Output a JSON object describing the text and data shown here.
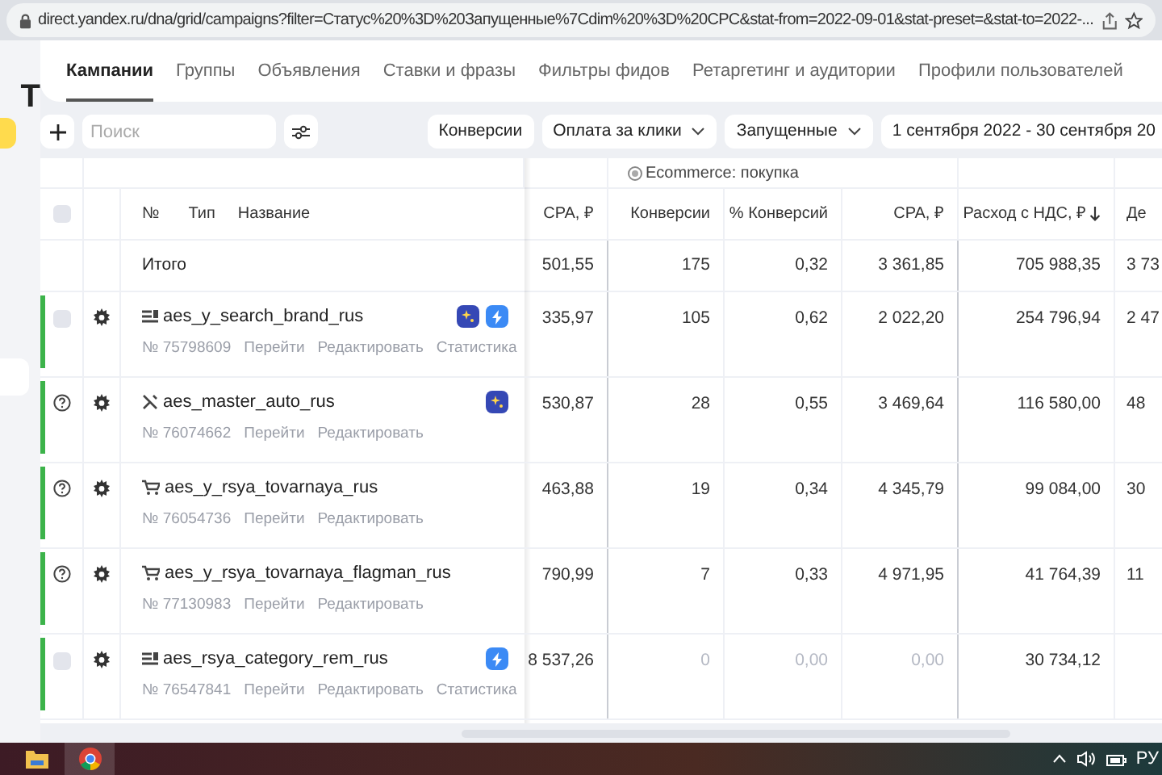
{
  "address_bar": {
    "url": "direct.yandex.ru/dna/grid/campaigns?filter=Статус%20%3D%20Запущенные%7Cdim%20%3D%20CPC&stat-from=2022-09-01&stat-preset=&stat-to=2022-..."
  },
  "sidebar": {
    "logo": "Т"
  },
  "tabs": [
    {
      "label": "Кампании",
      "selected": true
    },
    {
      "label": "Группы",
      "selected": false
    },
    {
      "label": "Объявления",
      "selected": false
    },
    {
      "label": "Ставки и фразы",
      "selected": false
    },
    {
      "label": "Фильтры фидов",
      "selected": false
    },
    {
      "label": "Ретаргетинг и аудитории",
      "selected": false
    },
    {
      "label": "Профили пользователей",
      "selected": false
    }
  ],
  "toolbar": {
    "search": {
      "placeholder": "Поиск"
    },
    "filters": [
      "Конверсии",
      "Оплата за клики",
      "Запущенные"
    ],
    "date_range": "1 сентября 2022 - 30 сентября 20"
  },
  "table": {
    "group_header": "Ecommerce: покупка",
    "columns": [
      "№",
      "Тип",
      "Название",
      "CPA, ₽",
      "Конверсии",
      "% Конверсий",
      "CPA, ₽",
      "Расход с НДС, ₽",
      "Де"
    ],
    "select_all": {
      "checked": false
    },
    "total": {
      "label": "Итого",
      "values": [
        "501,55",
        "175",
        "0,32",
        "3 361,85",
        "705 988,35",
        "3 73"
      ]
    },
    "rows": [
      {
        "status": {
          "kind": "checkbox",
          "checked": false
        },
        "type": {
          "kind": "list"
        },
        "name": "aes_y_search_brand_rus",
        "number": "№ 75798609",
        "links": [
          "Перейти",
          "Редактировать",
          "Статистика"
        ],
        "badges": [
          {
            "kind": "smart"
          },
          {
            "kind": "lightning"
          }
        ],
        "values": [
          {
            "text": "335,97",
            "dim": false
          },
          {
            "text": "105",
            "dim": false
          },
          {
            "text": "0,62",
            "dim": false
          },
          {
            "text": "2 022,20",
            "dim": false
          },
          {
            "text": "254 796,94",
            "dim": false
          },
          {
            "text": "2 47",
            "dim": false
          }
        ]
      },
      {
        "status": {
          "kind": "question"
        },
        "type": {
          "kind": "tools"
        },
        "name": "aes_master_auto_rus",
        "number": "№ 76074662",
        "links": [
          "Перейти",
          "Редактировать"
        ],
        "badges": [
          {
            "kind": "smart"
          }
        ],
        "values": [
          {
            "text": "530,87",
            "dim": false
          },
          {
            "text": "28",
            "dim": false
          },
          {
            "text": "0,55",
            "dim": false
          },
          {
            "text": "3 469,64",
            "dim": false
          },
          {
            "text": "116 580,00",
            "dim": false
          },
          {
            "text": "48",
            "dim": false
          }
        ]
      },
      {
        "status": {
          "kind": "question"
        },
        "type": {
          "kind": "cart"
        },
        "name": "aes_y_rsya_tovarnaya_rus",
        "number": "№ 76054736",
        "links": [
          "Перейти",
          "Редактировать"
        ],
        "badges": [],
        "values": [
          {
            "text": "463,88",
            "dim": false
          },
          {
            "text": "19",
            "dim": false
          },
          {
            "text": "0,34",
            "dim": false
          },
          {
            "text": "4 345,79",
            "dim": false
          },
          {
            "text": "99 084,00",
            "dim": false
          },
          {
            "text": "30",
            "dim": false
          }
        ]
      },
      {
        "status": {
          "kind": "question"
        },
        "type": {
          "kind": "cart"
        },
        "name": "aes_y_rsya_tovarnaya_flagman_rus",
        "number": "№ 77130983",
        "links": [
          "Перейти",
          "Редактировать"
        ],
        "badges": [],
        "values": [
          {
            "text": "790,99",
            "dim": false
          },
          {
            "text": "7",
            "dim": false
          },
          {
            "text": "0,33",
            "dim": false
          },
          {
            "text": "4 971,95",
            "dim": false
          },
          {
            "text": "41 764,39",
            "dim": false
          },
          {
            "text": "11",
            "dim": false
          }
        ]
      },
      {
        "status": {
          "kind": "checkbox",
          "checked": false
        },
        "type": {
          "kind": "list"
        },
        "name": "aes_rsya_category_rem_rus",
        "number": "№ 76547841",
        "links": [
          "Перейти",
          "Редактировать",
          "Статистика"
        ],
        "badges": [
          {
            "kind": "lightning"
          }
        ],
        "values": [
          {
            "text": "8 537,26",
            "dim": false
          },
          {
            "text": "0",
            "dim": true
          },
          {
            "text": "0,00",
            "dim": true
          },
          {
            "text": "0,00",
            "dim": true
          },
          {
            "text": "30 734,12",
            "dim": false
          }
        ]
      }
    ]
  },
  "taskbar": {
    "language": "РУ"
  }
}
